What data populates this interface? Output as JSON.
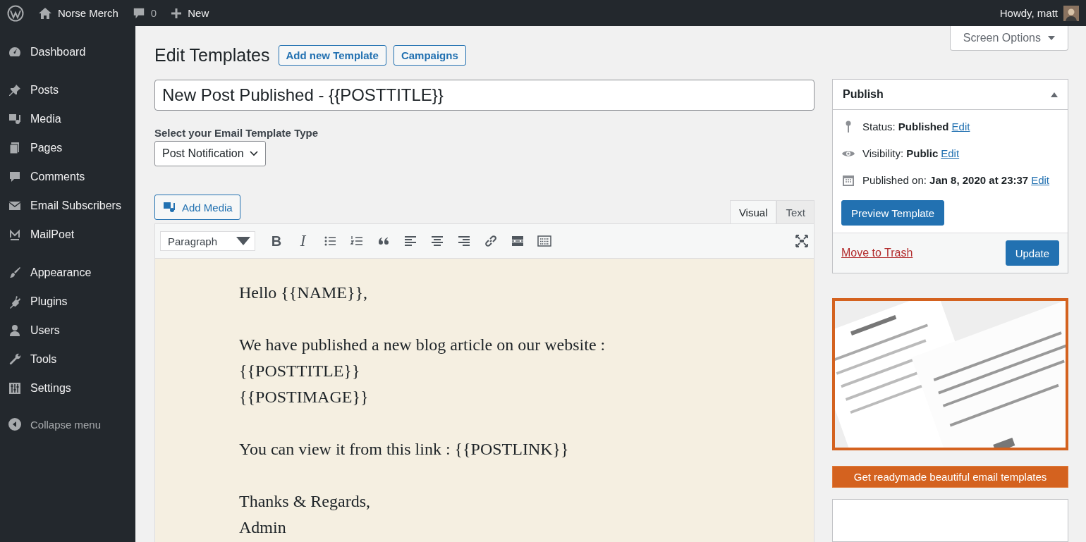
{
  "admin_bar": {
    "site_name": "Norse Merch",
    "comments_count": "0",
    "new_label": "New",
    "greeting": "Howdy, matt"
  },
  "sidebar": {
    "sections": [
      {
        "items": [
          {
            "label": "Dashboard"
          }
        ]
      },
      {
        "items": [
          {
            "label": "Posts"
          },
          {
            "label": "Media"
          },
          {
            "label": "Pages"
          },
          {
            "label": "Comments"
          },
          {
            "label": "Email Subscribers"
          },
          {
            "label": "MailPoet"
          }
        ]
      },
      {
        "items": [
          {
            "label": "Appearance"
          },
          {
            "label": "Plugins"
          },
          {
            "label": "Users"
          },
          {
            "label": "Tools"
          },
          {
            "label": "Settings"
          }
        ]
      }
    ],
    "collapse_label": "Collapse menu"
  },
  "screen_options": "Screen Options",
  "page": {
    "title": "Edit Templates",
    "actions": [
      "Add new Template",
      "Campaigns"
    ]
  },
  "template_title": {
    "value": "New Post Published - {{POSTTITLE}}"
  },
  "template_type": {
    "label": "Select your Email Template Type",
    "value": "Post Notification"
  },
  "editor": {
    "add_media": "Add Media",
    "tabs": [
      {
        "label": "Visual",
        "selected": true
      },
      {
        "label": "Text",
        "selected": false
      }
    ],
    "format": "Paragraph",
    "bold_glyph": "B",
    "italic_glyph": "I",
    "paragraphs": [
      [
        "Hello {{NAME}},"
      ],
      [
        "We have published a new blog article on our website :",
        "{{POSTTITLE}}",
        "{{POSTIMAGE}}"
      ],
      [
        "You can view it from this link : {{POSTLINK}}"
      ],
      [
        "Thanks & Regards,",
        "Admin"
      ]
    ]
  },
  "publish": {
    "title": "Publish",
    "rows": [
      {
        "text": "Status: **Published**",
        "link": "Edit"
      },
      {
        "text": "Visibility: **Public**",
        "link": "Edit"
      },
      {
        "text": "Published on: **Jan 8, 2020 at 23:37**",
        "link": "Edit"
      }
    ],
    "preview_button": "Preview Template",
    "trash_link": "Move to Trash",
    "update_button": "Update"
  },
  "promo": {
    "kind": "picture",
    "button": "Get readymade beautiful email templates"
  }
}
